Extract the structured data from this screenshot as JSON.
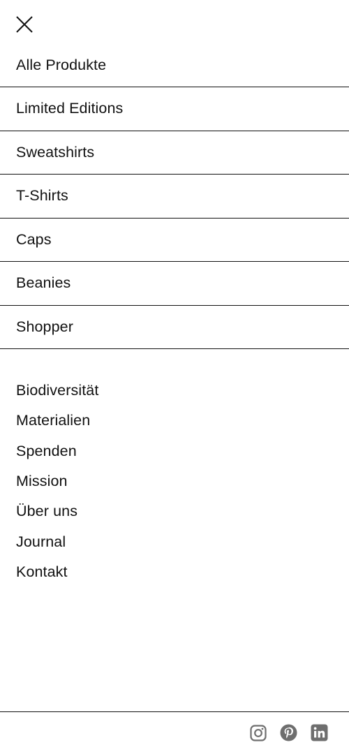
{
  "menu": {
    "close_icon": "close-icon",
    "product_categories": [
      {
        "label": "Alle Produkte"
      },
      {
        "label": "Limited Editions"
      },
      {
        "label": "Sweatshirts"
      },
      {
        "label": "T-Shirts"
      },
      {
        "label": "Caps"
      },
      {
        "label": "Beanies"
      },
      {
        "label": "Shopper"
      }
    ],
    "info_links": [
      {
        "label": "Biodiversität"
      },
      {
        "label": "Materialien"
      },
      {
        "label": "Spenden"
      },
      {
        "label": "Mission"
      },
      {
        "label": "Über uns"
      },
      {
        "label": "Journal"
      },
      {
        "label": "Kontakt"
      }
    ]
  },
  "social": [
    {
      "icon": "instagram-icon"
    },
    {
      "icon": "pinterest-icon"
    },
    {
      "icon": "linkedin-icon"
    }
  ],
  "colors": {
    "text": "#111111",
    "divider": "#111111",
    "social_icon": "#6e6e6e",
    "background": "#ffffff"
  }
}
